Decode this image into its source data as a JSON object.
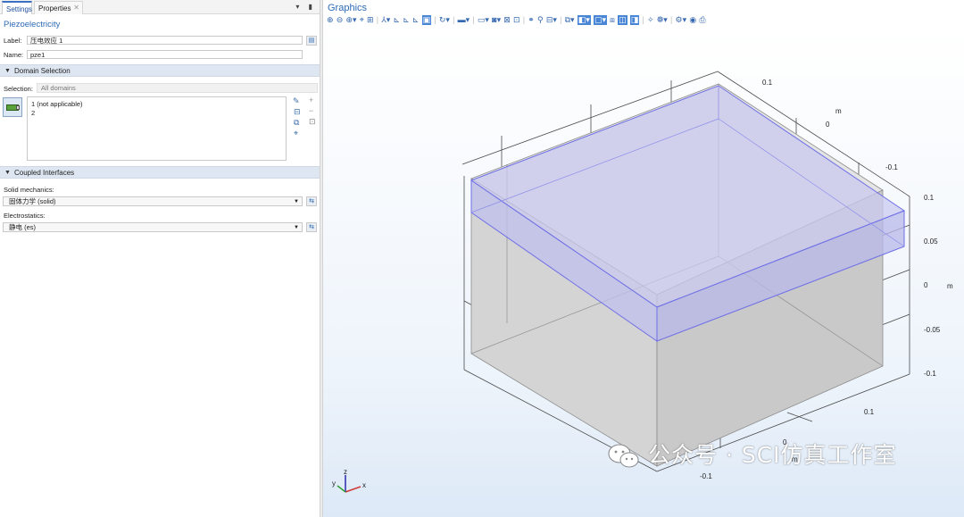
{
  "tabs": {
    "settings": "Settings",
    "properties": "Properties",
    "tools": "▾ ▮"
  },
  "panel": {
    "title": "Piezoelectricity",
    "label_caption": "Label:",
    "label_value": "压电效应 1",
    "name_caption": "Name:",
    "name_value": "pze1"
  },
  "domain_selection": {
    "header": "Domain Selection",
    "selection_caption": "Selection:",
    "selection_value": "All domains",
    "items": [
      "1 (not applicable)",
      "2"
    ]
  },
  "coupled_interfaces": {
    "header": "Coupled Interfaces",
    "solid_caption": "Solid mechanics:",
    "solid_value": "固体力学 (solid)",
    "electro_caption": "Electrostatics:",
    "electro_value": "静电 (es)"
  },
  "graphics": {
    "title": "Graphics",
    "ticks_right_y": [
      "0.1",
      "0",
      "-0.1"
    ],
    "ticks_right_unit": "m",
    "ticks_right_z": [
      "0.1",
      "0.05",
      "0",
      "-0.05",
      "-0.1"
    ],
    "ticks_right_z_unit": "m",
    "ticks_bottom_x": [
      "0.1",
      "0",
      "-0.1"
    ],
    "ticks_bottom_unit": "m",
    "triad": {
      "x": "x",
      "y": "y",
      "z": "z"
    }
  },
  "watermark": "公众号 · SCI仿真工作室",
  "colors": {
    "accent": "#2e6bb5",
    "section_bg": "#dde6f1",
    "box_fill": "#d2d2d2",
    "plate_edge": "#6f6fe6",
    "plate_fill": "#c8c8f0"
  }
}
